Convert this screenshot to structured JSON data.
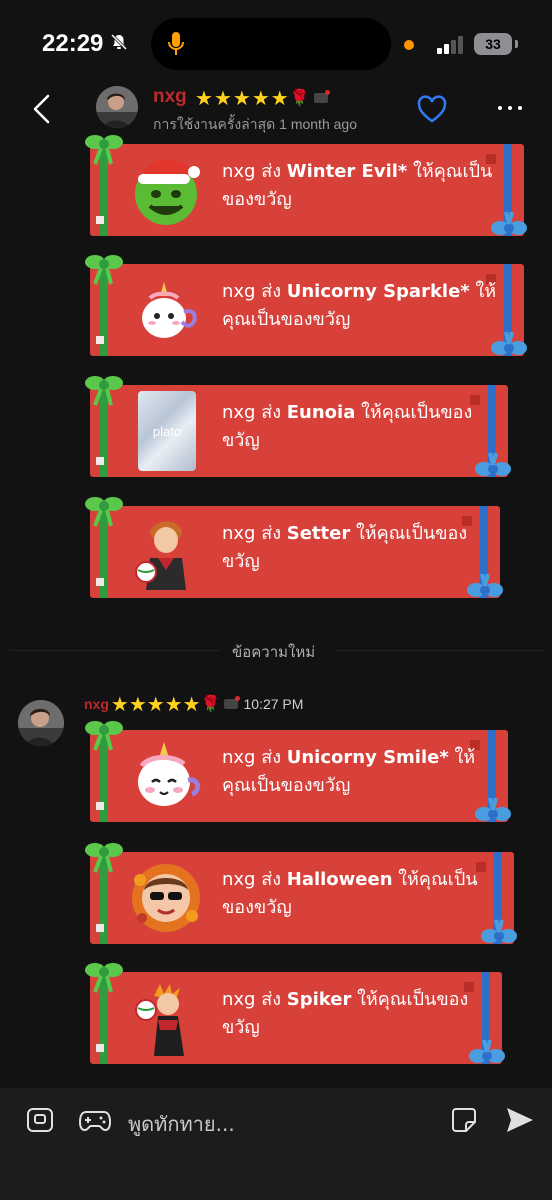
{
  "status_bar": {
    "time": "22:29",
    "battery": "33"
  },
  "header": {
    "name": "nxg",
    "last_active": "การใช้งานครั้งล่าสุด 1 month ago"
  },
  "gifts_top": [
    {
      "sender": "nxg",
      "verb": "ส่ง",
      "item": "Winter Evil*",
      "suffix": "ให้คุณเป็นของขวัญ"
    },
    {
      "sender": "nxg",
      "verb": "ส่ง",
      "item": "Unicorny Sparkle*",
      "suffix": "ให้คุณเป็นของขวัญ"
    },
    {
      "sender": "nxg",
      "verb": "ส่ง",
      "item": "Eunoia",
      "suffix": "ให้คุณเป็นของขวัญ"
    },
    {
      "sender": "nxg",
      "verb": "ส่ง",
      "item": "Setter",
      "suffix": "ให้คุณเป็นของขวัญ"
    }
  ],
  "separator": {
    "label": "ข้อความใหม่"
  },
  "message": {
    "name": "nxg",
    "time": "10:27 PM"
  },
  "gifts_bottom": [
    {
      "sender": "nxg",
      "verb": "ส่ง",
      "item": "Unicorny Smile*",
      "suffix": "ให้คุณเป็นของขวัญ"
    },
    {
      "sender": "nxg",
      "verb": "ส่ง",
      "item": "Halloween",
      "suffix": "ให้คุณเป็นของขวัญ"
    },
    {
      "sender": "nxg",
      "verb": "ส่ง",
      "item": "Spiker",
      "suffix": "ให้คุณเป็นของขวัญ"
    }
  ],
  "composer": {
    "placeholder": "พูดทักทาย..."
  },
  "thumb_labels": {
    "eunoia": "plato"
  },
  "icons": [
    "bell-slash-icon",
    "mic-icon",
    "signal-icon",
    "back-icon",
    "heart-icon",
    "more-icon",
    "gift-bow-icon",
    "emoji-keyboard-icon",
    "gamepad-icon",
    "sticker-icon",
    "send-icon"
  ],
  "colors": {
    "card_red": "#d8403a",
    "ribbon_green": "#2e9c3f",
    "ribbon_blue": "#2d6fc9",
    "name_red": "#c0282d",
    "star": "#ffd21f"
  }
}
